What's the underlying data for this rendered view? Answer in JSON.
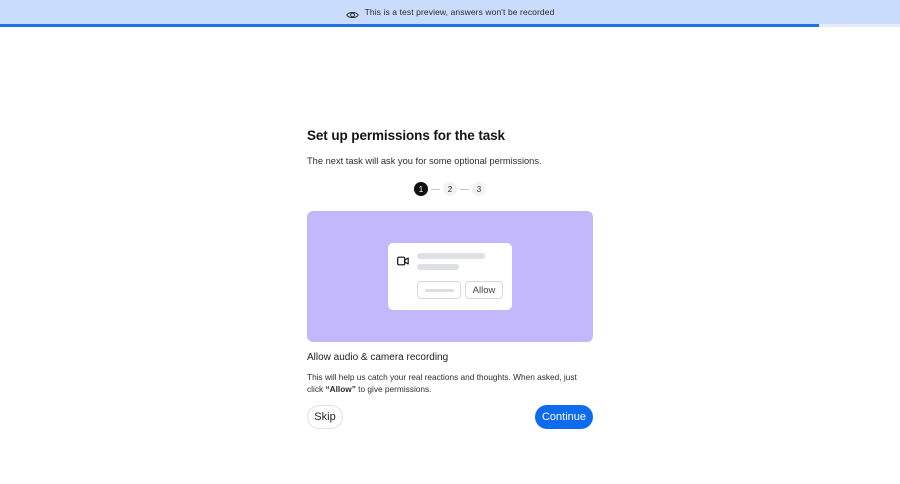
{
  "banner": {
    "icon": "eye-icon",
    "text": "This is a test preview, answers won't be recorded"
  },
  "progress": {
    "fraction": 0.91,
    "color": "#1a73e8"
  },
  "page": {
    "title": "Set up permissions for the task",
    "subtitle": "The next task will ask you for some optional permissions."
  },
  "stepper": {
    "steps": [
      "1",
      "2",
      "3"
    ],
    "current": 1
  },
  "illustration": {
    "background": "#c3b8fb",
    "icon": "video-camera-icon",
    "allow_label": "Allow"
  },
  "permission": {
    "title": "Allow audio & camera recording",
    "desc_before": "This will help us catch your real reactions and thoughts. When asked, just click ",
    "desc_bold": "“Allow”",
    "desc_after": " to give permissions."
  },
  "actions": {
    "skip_label": "Skip",
    "continue_label": "Continue",
    "accent": "#0d6bf0"
  }
}
